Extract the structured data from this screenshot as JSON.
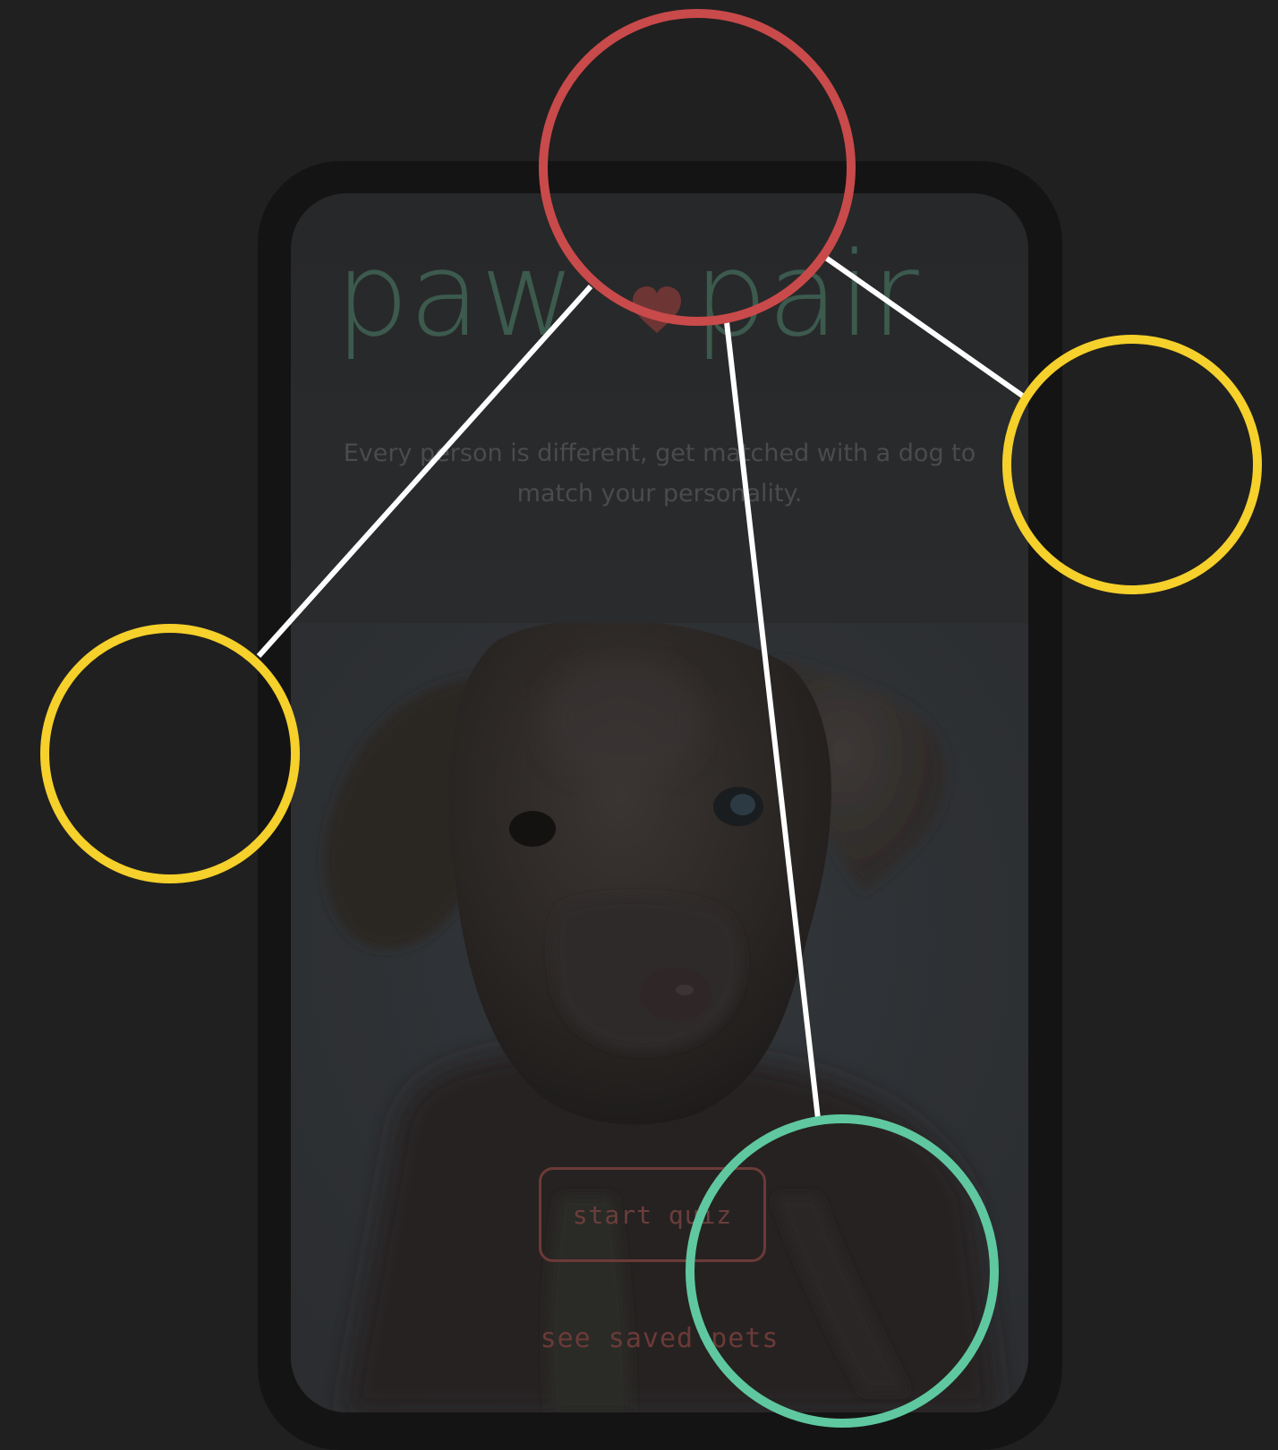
{
  "app": {
    "logo_left": "paw",
    "logo_right": "pair",
    "tagline": "Every person is different, get matched with a dog to match your personality.",
    "start_button_label": "start quiz",
    "saved_pets_label": "see saved pets"
  },
  "colors": {
    "page_background": "#202020",
    "phone_frame": "#141414",
    "logo_green": "#3c5a4e",
    "heart_red": "#6e3535",
    "button_border": "#6b3a37",
    "annotation_red": "#c94a4a",
    "annotation_yellow": "#f6d02b",
    "annotation_green": "#5fc8a0",
    "annotation_line": "#ffffff"
  },
  "annotations": {
    "icons": [
      "heart-icon",
      "circle-red",
      "circle-yellow-left",
      "circle-yellow-right",
      "circle-green"
    ]
  }
}
